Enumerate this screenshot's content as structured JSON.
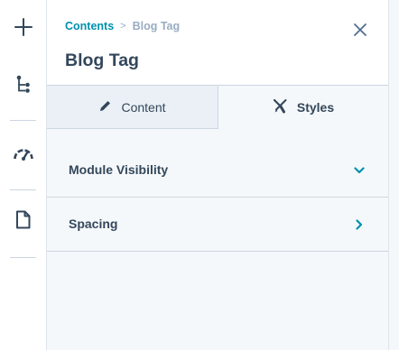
{
  "rail": {
    "items": [
      {
        "name": "add",
        "icon": "plus-icon"
      },
      {
        "name": "tree",
        "icon": "tree-structure-icon"
      },
      {
        "name": "optimize",
        "icon": "speedometer-icon"
      },
      {
        "name": "page",
        "icon": "document-icon"
      }
    ]
  },
  "header": {
    "breadcrumb_root": "Contents",
    "breadcrumb_sep": ">",
    "breadcrumb_current": "Blog Tag",
    "title": "Blog Tag"
  },
  "tabs": [
    {
      "label": "Content",
      "icon": "pencil-icon",
      "active": false
    },
    {
      "label": "Styles",
      "icon": "styles-icon",
      "active": true
    }
  ],
  "sections": [
    {
      "label": "Module Visibility",
      "state": "expanded",
      "icon": "chevron-down-icon"
    },
    {
      "label": "Spacing",
      "state": "collapsed",
      "icon": "chevron-right-icon"
    }
  ],
  "colors": {
    "accent": "#0091ae",
    "text": "#33475b",
    "muted": "#99acc2",
    "panel_bg": "#f5f8fa",
    "tab_inactive_bg": "#eaf0f6",
    "border": "#cbd6e2"
  }
}
